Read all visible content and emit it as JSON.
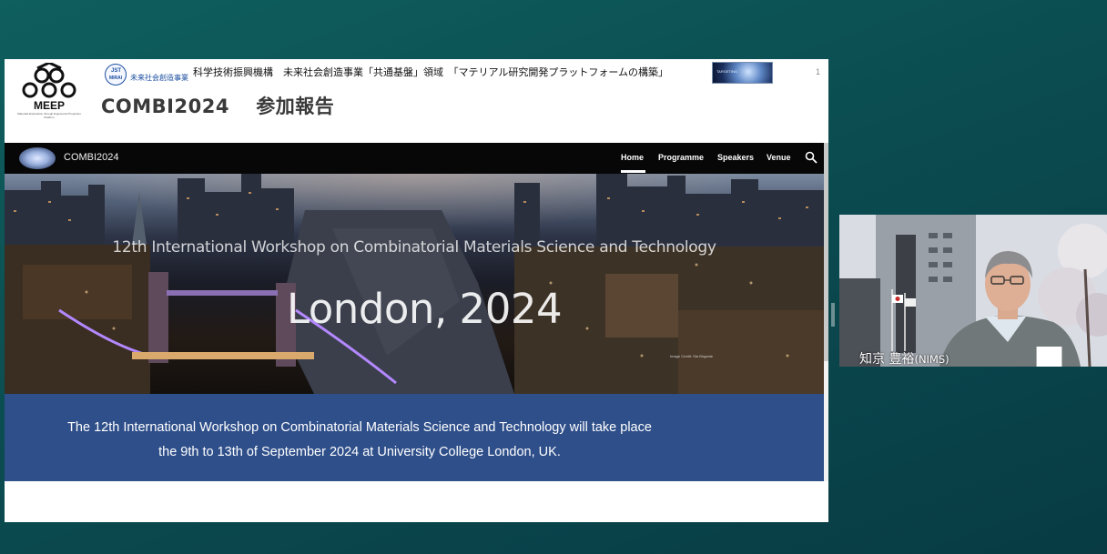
{
  "slide": {
    "logos": {
      "meep_text": "MEEP",
      "meep_subtext": "Materials Exploration through Engineered Properties Platform",
      "jst_mark_top": "JST",
      "jst_mark_bottom": "MIRAI",
      "jst_name": "未来社会創造事業"
    },
    "program_title": "科学技術振興機構　未来社会創造事業「共通基盤」領域　「マテリアル研究開発プラットフォームの構築」",
    "page_number": "1",
    "title": "COMBI2024　 参加報告",
    "thumbnail_caption": "TARGETING"
  },
  "website": {
    "site_name": "COMBI2024",
    "nav": {
      "home": "Home",
      "programme": "Programme",
      "speakers": "Speakers",
      "venue": "Venue",
      "search_icon": "search-icon"
    },
    "hero": {
      "subtitle": "12th International Workshop on Combinatorial Materials Science and Technology",
      "title": "London, 2024",
      "image_credit": "Image Credit: Sta Brigante"
    },
    "info": {
      "line1": "The 12th International Workshop on Combinatorial Materials Science and Technology will take place",
      "line2": "the 9th to 13th of September 2024 at University College London, UK."
    },
    "colors": {
      "nav_bg": "#070707",
      "band_bg": "#2f4f8a"
    }
  },
  "video": {
    "participant_name": "知京 豊裕",
    "participant_org": "(NIMS)",
    "signal_icon": "signal-bars-icon"
  },
  "colors": {
    "background": "#0b4d51",
    "slide_bg": "#ffffff"
  }
}
